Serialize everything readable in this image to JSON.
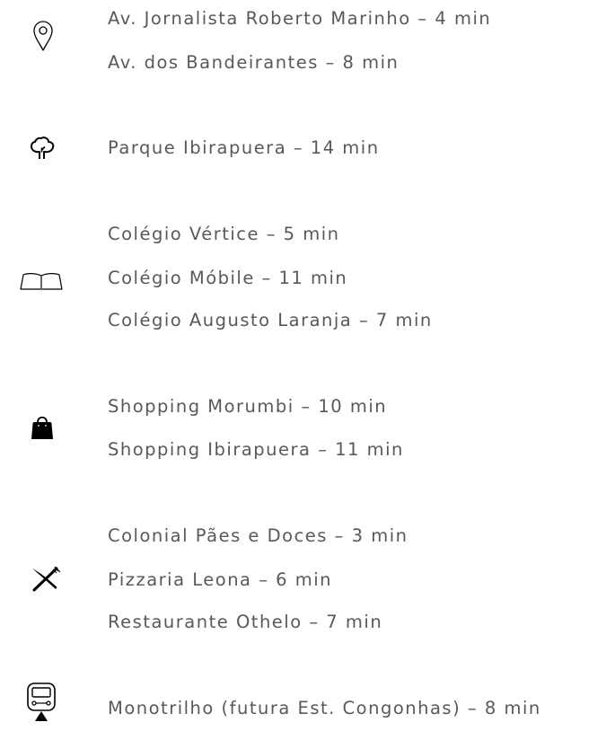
{
  "colors": {
    "text": "#595959",
    "icon": "#000000",
    "background": "#ffffff"
  },
  "groups": [
    {
      "icon": "map-pin-icon",
      "items": [
        "Av. Jornalista Roberto Marinho – 4 min",
        "Av. dos Bandeirantes – 8 min"
      ]
    },
    {
      "icon": "tree-icon",
      "items": [
        "Parque Ibirapuera – 14 min"
      ]
    },
    {
      "icon": "open-book-icon",
      "items": [
        "Colégio Vértice – 5 min",
        "Colégio Móbile – 11 min",
        "Colégio Augusto Laranja – 7 min"
      ]
    },
    {
      "icon": "shopping-bag-icon",
      "items": [
        "Shopping Morumbi – 10 min",
        "Shopping Ibirapuera – 11 min"
      ]
    },
    {
      "icon": "fork-knife-icon",
      "items": [
        "Colonial Pães e Doces – 3 min",
        "Pizzaria Leona – 6 min",
        "Restaurante Othelo – 7 min"
      ]
    },
    {
      "icon": "monorail-icon",
      "items": [
        "Monotrilho (futura Est. Congonhas) – 8 min"
      ]
    }
  ]
}
